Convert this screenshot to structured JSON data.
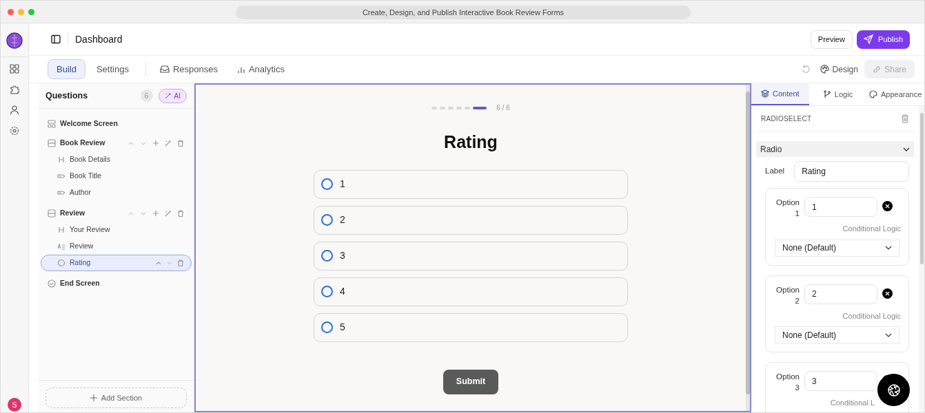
{
  "window": {
    "title": "Create, Design, and Publish Interactive Book Review Forms"
  },
  "header": {
    "title": "Dashboard",
    "buttons": [
      {
        "label": "Preview",
        "kind": "secondary"
      },
      {
        "label": "Publish",
        "kind": "primary"
      }
    ]
  },
  "user": {
    "initial": "S"
  },
  "tabs": [
    {
      "label": "Build",
      "selected": true
    },
    {
      "label": "Settings",
      "selected": false
    },
    {
      "label": "Responses",
      "selected": false
    },
    {
      "label": "Analytics",
      "selected": false
    }
  ],
  "toolbar": {
    "design": "Design",
    "share": "Share"
  },
  "questions": {
    "title": "Questions",
    "count": "6",
    "ai": "AI",
    "add_section": "Add Section",
    "items": [
      {
        "kind": "welcome",
        "label": "Welcome Screen",
        "selected": false
      },
      {
        "kind": "section",
        "label": "Book Review",
        "selected": false,
        "children": [
          {
            "kind": "heading",
            "label": "Book Details",
            "selected": false
          },
          {
            "kind": "short",
            "label": "Book Title",
            "selected": false
          },
          {
            "kind": "short",
            "label": "Author",
            "selected": false
          }
        ]
      },
      {
        "kind": "section",
        "label": "Review",
        "selected": false,
        "children": [
          {
            "kind": "heading",
            "label": "Your Review",
            "selected": false
          },
          {
            "kind": "long",
            "label": "Review",
            "selected": false
          },
          {
            "kind": "radio",
            "label": "Rating",
            "selected": true
          }
        ]
      },
      {
        "kind": "end",
        "label": "End Screen",
        "selected": false
      }
    ]
  },
  "preview": {
    "steps": [
      {
        "selected": false
      },
      {
        "selected": false
      },
      {
        "selected": false
      },
      {
        "selected": false
      },
      {
        "selected": false
      },
      {
        "selected": true
      }
    ],
    "step_text": "6 / 6",
    "title": "Rating",
    "options": [
      {
        "label": "1",
        "selected": false
      },
      {
        "label": "2",
        "selected": false
      },
      {
        "label": "3",
        "selected": false
      },
      {
        "label": "4",
        "selected": false
      },
      {
        "label": "5",
        "selected": false
      }
    ],
    "submit": "Submit"
  },
  "inspector": {
    "tabs": [
      {
        "label": "Content",
        "selected": true
      },
      {
        "label": "Logic",
        "selected": false
      },
      {
        "label": "Appearance",
        "selected": false
      }
    ],
    "type": "RADIOSELECT",
    "group": "Radio",
    "label_caption": "Label",
    "label_value": "Rating",
    "options": [
      {
        "caption": "Option",
        "number": "1",
        "value": "1",
        "logic_caption": "Conditional Logic",
        "logic_value": "None (Default)"
      },
      {
        "caption": "Option",
        "number": "2",
        "value": "2",
        "logic_caption": "Conditional Logic",
        "logic_value": "None (Default)"
      },
      {
        "caption": "Option",
        "number": "3",
        "value": "3",
        "logic_caption": "Conditional L"
      }
    ]
  }
}
